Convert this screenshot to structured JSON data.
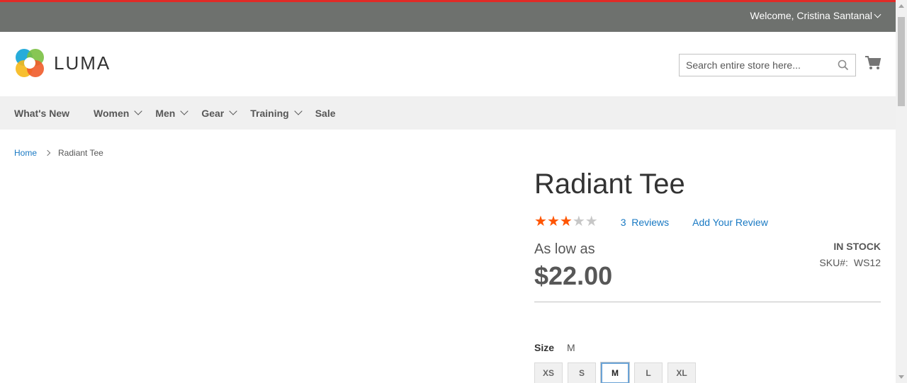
{
  "topbar": {
    "welcome": "Welcome, Cristina Santanal"
  },
  "header": {
    "logo_text": "LUMA",
    "search_placeholder": "Search entire store here..."
  },
  "nav": {
    "items": [
      {
        "label": "What's New"
      },
      {
        "label": "Women"
      },
      {
        "label": "Men"
      },
      {
        "label": "Gear"
      },
      {
        "label": "Training"
      },
      {
        "label": "Sale"
      }
    ]
  },
  "breadcrumb": {
    "home": "Home",
    "current": "Radiant Tee"
  },
  "product": {
    "title": "Radiant Tee",
    "rating_stars": 3,
    "rating_max": 5,
    "reviews_count": "3",
    "reviews_label": "Reviews",
    "add_review": "Add Your Review",
    "as_low_as": "As low as",
    "price": "$22.00",
    "stock": "IN STOCK",
    "sku_label": "SKU#:",
    "sku": "WS12",
    "size_label": "Size",
    "size_selected": "M",
    "sizes": [
      "XS",
      "S",
      "M",
      "L",
      "XL"
    ]
  },
  "colors": {
    "accent_red": "#e02b27",
    "topbar_bg": "#6e716e",
    "link": "#1979c3",
    "star_on": "#ff5501",
    "star_off": "#c7c7c7"
  }
}
